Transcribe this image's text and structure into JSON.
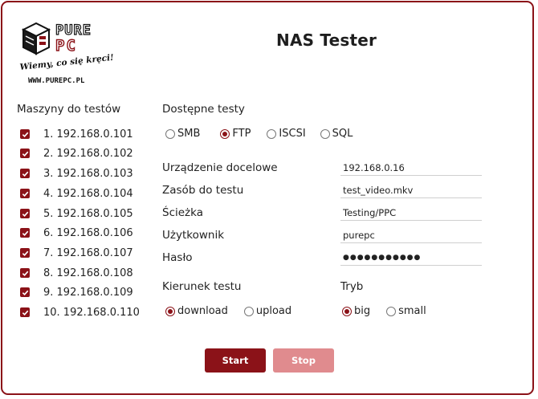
{
  "app": {
    "title": "NAS Tester",
    "logo_text": "PURE PC",
    "logo_slogan": "Wiemy, co się kręci!",
    "logo_url": "WWW.PUREPC.PL"
  },
  "machines": {
    "label": "Maszyny do testów",
    "items": [
      {
        "label": "1. 192.168.0.101",
        "checked": true
      },
      {
        "label": "2. 192.168.0.102",
        "checked": true
      },
      {
        "label": "3. 192.168.0.103",
        "checked": true
      },
      {
        "label": "4. 192.168.0.104",
        "checked": true
      },
      {
        "label": "5. 192.168.0.105",
        "checked": true
      },
      {
        "label": "6. 192.168.0.106",
        "checked": true
      },
      {
        "label": "7. 192.168.0.107",
        "checked": true
      },
      {
        "label": "8. 192.168.0.108",
        "checked": true
      },
      {
        "label": "9. 192.168.0.109",
        "checked": true
      },
      {
        "label": "10. 192.168.0.110",
        "checked": true
      }
    ]
  },
  "tests": {
    "label": "Dostępne testy",
    "options": [
      {
        "label": "SMB",
        "selected": false
      },
      {
        "label": "FTP",
        "selected": true
      },
      {
        "label": "ISCSI",
        "selected": false
      },
      {
        "label": "SQL",
        "selected": false
      }
    ]
  },
  "fields": {
    "device": {
      "label": "Urządzenie docelowe",
      "value": "192.168.0.16"
    },
    "resource": {
      "label": "Zasób do testu",
      "value": "test_video.mkv"
    },
    "path": {
      "label": "Ścieżka",
      "value": "Testing/PPC"
    },
    "user": {
      "label": "Użytkownik",
      "value": "purepc"
    },
    "password": {
      "label": "Hasło",
      "value": "●●●●●●●●●●●"
    }
  },
  "direction": {
    "label": "Kierunek testu",
    "options": [
      {
        "label": "download",
        "selected": true
      },
      {
        "label": "upload",
        "selected": false
      }
    ]
  },
  "mode": {
    "label": "Tryb",
    "options": [
      {
        "label": "big",
        "selected": true
      },
      {
        "label": "small",
        "selected": false
      }
    ]
  },
  "buttons": {
    "start": "Start",
    "stop": "Stop"
  },
  "colors": {
    "accent": "#8b1218",
    "stop_button": "#e08b8e"
  }
}
